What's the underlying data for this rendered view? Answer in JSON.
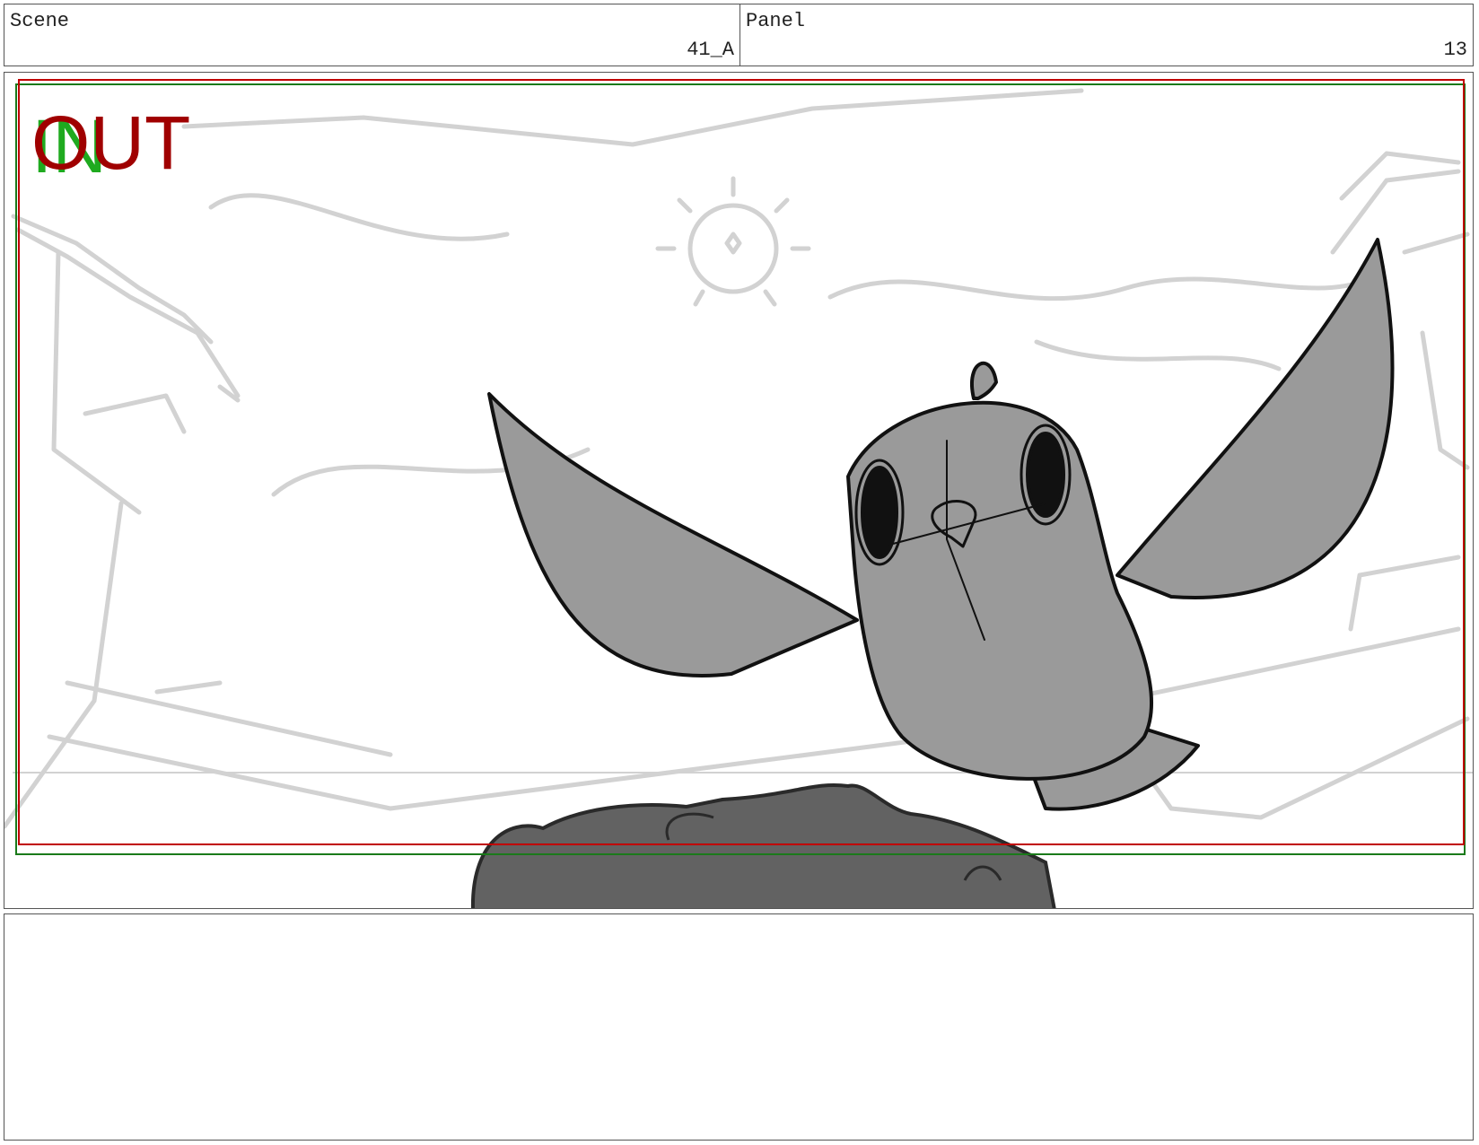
{
  "header": {
    "scene_label": "Scene",
    "scene_value": "41_A",
    "panel_label": "Panel",
    "panel_value": "13"
  },
  "frame": {
    "in_label": "IN",
    "out_label": "OUT",
    "colors": {
      "in_guide": "#1a7a1a",
      "out_guide": "#c00000",
      "in_text": "#1faa1f",
      "out_text": "#a00000",
      "bird_fill": "#9a9a9a",
      "rock_fill": "#626262",
      "sketch": "#cfcfcf"
    }
  },
  "notes": {
    "text": ""
  }
}
